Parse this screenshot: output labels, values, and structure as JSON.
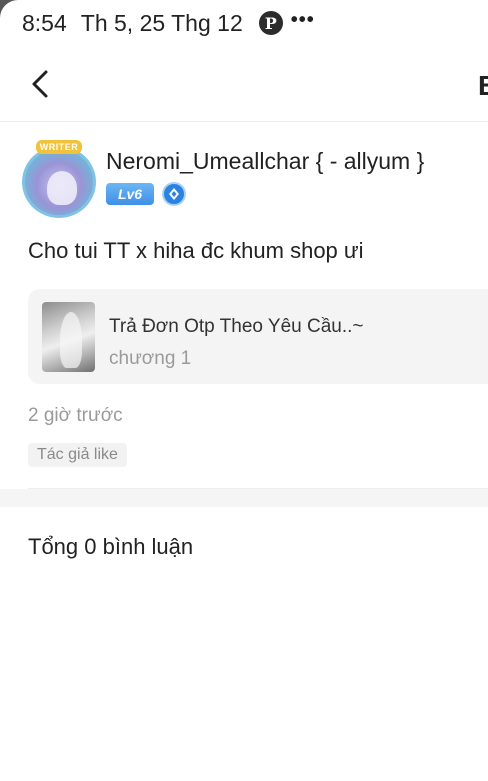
{
  "status_bar": {
    "time": "8:54",
    "date": "Th 5, 25 Thg 12",
    "pinterest_glyph": "P",
    "more_glyph": "•••"
  },
  "nav": {
    "back_icon": "chevron-left-icon",
    "title_partial": "B"
  },
  "post": {
    "avatar_badge": "WRITER",
    "username": "Neromi_Umeallchar { - allyum }",
    "level": "Lv6",
    "text": "Cho tui TT x hiha đc khum shop ưi",
    "time": "2 giờ trước",
    "author_like": "Tác giả like"
  },
  "story": {
    "title": "Trả Đơn Otp Theo Yêu Cầu..~",
    "chapter": "chương 1"
  },
  "comments": {
    "total_label": "Tổng 0 bình luận"
  },
  "colors": {
    "level_badge": "#3e8fe6",
    "verify_badge": "#2c82e0",
    "muted_text": "#9a9a9a",
    "card_bg": "#f4f4f4"
  }
}
